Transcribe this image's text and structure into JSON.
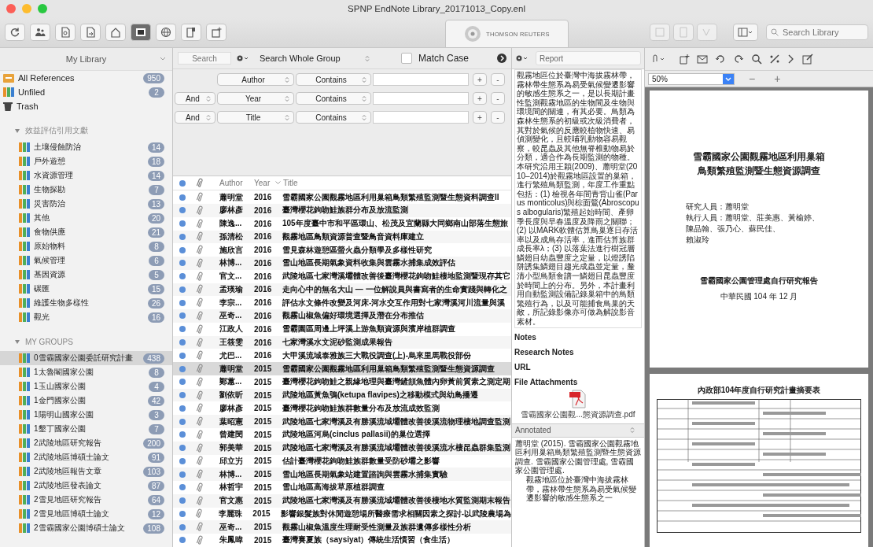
{
  "window": {
    "title": "SPNP EndNote Library_20171013_Copy.enl"
  },
  "toolbar": {
    "brand": "THOMSON REUTERS",
    "search": {
      "placeholder": "Search Library"
    }
  },
  "sidebar": {
    "header": "My Library",
    "fixed": [
      {
        "kind": "all",
        "label": "All References",
        "count": "950"
      },
      {
        "kind": "unfiled",
        "label": "Unfiled",
        "count": "2"
      },
      {
        "kind": "trash",
        "label": "Trash"
      }
    ],
    "group_sets": [
      {
        "name": "效益評估引用文獻",
        "expanded": true,
        "groups": [
          {
            "label": "土壤侵蝕防治",
            "count": "14",
            "selected": false
          },
          {
            "label": "戶外遊憩",
            "count": "18",
            "selected": false
          },
          {
            "label": "水資源管理",
            "count": "14",
            "selected": false
          },
          {
            "label": "生物探勘",
            "count": "7",
            "selected": false
          },
          {
            "label": "災害防治",
            "count": "13",
            "selected": false
          },
          {
            "label": "其他",
            "count": "20",
            "selected": false
          },
          {
            "label": "食物供應",
            "count": "21",
            "selected": false
          },
          {
            "label": "原始物料",
            "count": "8",
            "selected": false
          },
          {
            "label": "氣候管理",
            "count": "6",
            "selected": false
          },
          {
            "label": "基因資源",
            "count": "5",
            "selected": false
          },
          {
            "label": "碳匯",
            "count": "15",
            "selected": false
          },
          {
            "label": "維護生物多樣性",
            "count": "26",
            "selected": false
          },
          {
            "label": "觀光",
            "count": "16",
            "selected": false
          }
        ]
      },
      {
        "name": "MY GROUPS",
        "expanded": true,
        "groups": [
          {
            "label": "0雪霸國家公園委託研究計畫",
            "count": "438",
            "selected": true
          },
          {
            "label": "1太魯閣國家公園",
            "count": "8",
            "selected": false
          },
          {
            "label": "1玉山國家公園",
            "count": "4",
            "selected": false
          },
          {
            "label": "1金門國家公園",
            "count": "42",
            "selected": false
          },
          {
            "label": "1陽明山國家公園",
            "count": "3",
            "selected": false
          },
          {
            "label": "1墾丁國家公園",
            "count": "7",
            "selected": false
          },
          {
            "label": "2武陵地區研究報告",
            "count": "200",
            "selected": false
          },
          {
            "label": "2武陵地區博碩士論文",
            "count": "91",
            "selected": false
          },
          {
            "label": "2武陵地區報告文章",
            "count": "103",
            "selected": false
          },
          {
            "label": "2武陵地區發表論文",
            "count": "87",
            "selected": false
          },
          {
            "label": "2雪見地區研究報告",
            "count": "64",
            "selected": false
          },
          {
            "label": "2雪見地區博碩士論文",
            "count": "12",
            "selected": false
          },
          {
            "label": "2雪霸國家公園博碩士論文",
            "count": "108",
            "selected": false
          }
        ]
      }
    ]
  },
  "search_panel": {
    "search": {
      "placeholder": "Search"
    },
    "scope": "Search Whole Group",
    "match_case": {
      "label": "Match Case",
      "checked": false
    },
    "criteria": [
      {
        "field": "Author",
        "operator": "Contains",
        "buttons": [
          "+",
          "-"
        ]
      },
      {
        "conjunction": "And",
        "field": "Year",
        "operator": "Contains",
        "buttons": [
          "+",
          "-"
        ]
      },
      {
        "conjunction": "And",
        "field": "Title",
        "operator": "Contains",
        "buttons": [
          "+",
          "-"
        ]
      }
    ]
  },
  "table": {
    "columns": [
      "Author",
      "Year",
      "Title"
    ],
    "rows": [
      {
        "author": "蕭明堂",
        "year": "2016",
        "title": "雪霸國家公園觀霧地區利用巢箱鳥類繁殖監測暨生態資料調查II",
        "unread": true,
        "attachment": true,
        "selected": false
      },
      {
        "author": "廖林彥",
        "year": "2016",
        "title": "臺灣櫻花鉤吻鮭族群分布及放流監測",
        "unread": true,
        "attachment": true,
        "selected": false
      },
      {
        "author": "陳逸...",
        "year": "2016",
        "title": "105年度臺中市和平區環山、松茂及宜蘭縣大同鄉南山部落生態旅",
        "unread": true,
        "attachment": true,
        "selected": false
      },
      {
        "author": "孫清松",
        "year": "2016",
        "title": "觀霧地區鳥類資源普查暨鳥音資料庫建立",
        "unread": true,
        "attachment": true,
        "selected": false
      },
      {
        "author": "施欣言",
        "year": "2016",
        "title": "雪見森林遊憩區螢火蟲分類學及多樣性研究",
        "unread": true,
        "attachment": true,
        "selected": false
      },
      {
        "author": "林博...",
        "year": "2016",
        "title": "雪山地區長期氣象資料收集與雲霧水捕集成效評估",
        "unread": true,
        "attachment": true,
        "selected": false
      },
      {
        "author": "官文...",
        "year": "2016",
        "title": "武陵地區七家灣溪壩體改善後臺灣櫻花鉤吻鮭棲地監測暨現存其它",
        "unread": true,
        "attachment": true,
        "selected": false
      },
      {
        "author": "孟瑛瑜",
        "year": "2016",
        "title": "走向心中的無名大山 — 一位解說員與書寫者的生命實踐與轉化之",
        "unread": true,
        "attachment": true,
        "selected": false
      },
      {
        "author": "李宗...",
        "year": "2016",
        "title": "評估水文條件改變及河床-河水交互作用對七家灣溪河川流量與溪",
        "unread": true,
        "attachment": true,
        "selected": false
      },
      {
        "author": "巫奇...",
        "year": "2016",
        "title": "觀霧山椒魚偏好環境選擇及潛在分布推估",
        "unread": true,
        "attachment": true,
        "selected": false
      },
      {
        "author": "江政人",
        "year": "2016",
        "title": "雪霸園區周邊上坪溪上游魚類資源與濱岸植群調查",
        "unread": true,
        "attachment": true,
        "selected": false
      },
      {
        "author": "王筱雯",
        "year": "2016",
        "title": "七家灣溪水文泥砂監測成果報告",
        "unread": true,
        "attachment": true,
        "selected": false
      },
      {
        "author": "尤巴...",
        "year": "2016",
        "title": "大甲溪流域泰雅族三大戰役調查(上)-烏來里馬戰役部份",
        "unread": true,
        "attachment": true,
        "selected": false
      },
      {
        "author": "蕭明堂",
        "year": "2015",
        "title": "雪霸國家公園觀霧地區利用巢箱鳥類繁殖監測暨生態資源調查",
        "unread": true,
        "attachment": true,
        "selected": true
      },
      {
        "author": "鄭蕙...",
        "year": "2015",
        "title": "臺灣櫻花鉤吻鮭之親緣地理與臺灣鏟頷魚體內卵黃前質素之測定期",
        "unread": true,
        "attachment": true,
        "selected": false
      },
      {
        "author": "劉依昕",
        "year": "2015",
        "title": "武陵地區黃魚鴞(ketupa flavipes)之移動模式與幼鳥播遷",
        "unread": true,
        "attachment": true,
        "selected": false
      },
      {
        "author": "廖林彥",
        "year": "2015",
        "title": "臺灣櫻花鉤吻鮭族群數量分布及放流成效監測",
        "unread": true,
        "attachment": true,
        "selected": false
      },
      {
        "author": "葉昭憲",
        "year": "2015",
        "title": "武陵地區七家灣溪及有勝溪流域壩體改善後溪流物理棲地調查監測",
        "unread": true,
        "attachment": true,
        "selected": false
      },
      {
        "author": "曾建閔",
        "year": "2015",
        "title": "武陵地區河烏(cinclus pallasii)的巢位選擇",
        "unread": true,
        "attachment": true,
        "selected": false
      },
      {
        "author": "郭美華",
        "year": "2015",
        "title": "武陵地區七家灣溪及有勝溪流域壩體改善後溪流水棲昆蟲群集監測",
        "unread": true,
        "attachment": true,
        "selected": false
      },
      {
        "author": "邱立屴",
        "year": "2015",
        "title": "估計臺灣櫻花鉤吻鮭族群數量受防砂壩之影響",
        "unread": true,
        "attachment": true,
        "selected": false
      },
      {
        "author": "林博...",
        "year": "2015",
        "title": "雪山地區長期氣象站建置諮詢與雲霧水捕集實驗",
        "unread": true,
        "attachment": true,
        "selected": false
      },
      {
        "author": "林哲宇",
        "year": "2015",
        "title": "雪山地區高海拔草原植群調查",
        "unread": true,
        "attachment": true,
        "selected": false
      },
      {
        "author": "官文惠",
        "year": "2015",
        "title": "武陵地區七家灣溪及有勝溪流域壩體改善後棲地水質監測期末報告",
        "unread": true,
        "attachment": true,
        "selected": false
      },
      {
        "author": "李麗珠",
        "year": "2015",
        "title": "影響銀髮族對休閒遊憩場所醫療需求相關因素之探討-以武陵農場為",
        "unread": true,
        "attachment": true,
        "selected": false
      },
      {
        "author": "巫奇...",
        "year": "2015",
        "title": "觀霧山椒魚溫度生理耐受性測量及族群遺傳多樣性分析",
        "unread": true,
        "attachment": true,
        "selected": false
      },
      {
        "author": "朱鳳暐",
        "year": "2015",
        "title": "臺灣賽夏族（saysiyat）傳統生活慣習（食生活）",
        "unread": true,
        "attachment": true,
        "selected": false
      }
    ]
  },
  "reference_panel": {
    "style": "Report",
    "abstract": "觀霧地區位於臺灣中海拔霧林帶，霧林帶生態系為易受氣候變遷影響的敏感生態系之一，是以長期計畫性監測觀霧地區的生物間及生物與環境間的關連，有其必要。鳥類為森林生態系的初級或次級消費者，其對於氣候的反應較植物快速、易偵測變化，且較哺乳動物容易觀察，較昆蟲及其他無脊椎動物易於分類，適合作為長期監測的物種。本研究沿用王穎(2009)、蕭明堂(2010–2014)於觀霧地區設置的巢箱，進行繁殖鳥類監測，年度工作重點包括：(1) 檢視各年間青背山雀(Parus monticolus)與棕面鶯(Abroscopus albogularis)繁殖起始時間、產卵季長度與早春溫度及降雨之關聯；(2) 以MARK軟體估算鳥巢逐日存活率以及成鳥存活率，進而估算族群成長率λ；(3) 以落葉法進行樹冠層鱗翅目幼蟲豐度之定量，以燈誘陷阱誘集鱗翅目趨光成蟲並定量，釐清小型鳥類食譜一鱗翅目昆蟲豐度於時間上的分布。另外，本計畫利用自動監測設備記錄巢箱中的鳥類繁殖行為，以及可能捕食鳥巢的天敵，所記錄影像亦可做為解說影音素材。",
    "fields": [
      "Notes",
      "Research Notes",
      "URL",
      "File Attachments"
    ],
    "attachment": {
      "filename": "雪霸國家公園觀...態資源調查.pdf"
    },
    "output_style": "Annotated",
    "citation": "蕭明堂 (2015). 雪霸國家公園觀霧地區利用巢箱鳥類繁殖監測暨生態資源調查. 雪霸國家公園管理處, 雪霸國家公園管理處.",
    "annotation": "觀霧地區位於臺灣中海拔霧林帶，霧林帶生態系為易受氣候變遷影響的敏感生態系之一"
  },
  "pdf_viewer": {
    "zoom": "50%",
    "zoom_out": "−",
    "zoom_in": "+",
    "cover": {
      "title": [
        "雪霸國家公園觀霧地區利用巢箱",
        "鳥類繁殖監測暨生態資源調查"
      ],
      "credits": [
        "研究人員：蕭明堂",
        "執行人員：蕭明堂、莊美惠、黃榆婷、",
        "陳品翰、張乃心、蘇民佳、",
        "賴淑玲"
      ],
      "publisher": "雪霸國家公園管理處自行研究報告",
      "date": "中華民國 104 年 12 月"
    },
    "second_page": {
      "title": "內政部104年度自行研究計畫摘要表"
    }
  }
}
